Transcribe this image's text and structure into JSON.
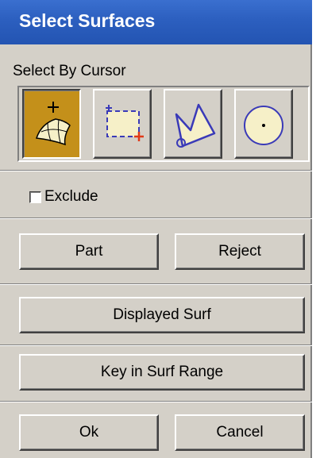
{
  "window": {
    "title": "Select Surfaces"
  },
  "select_by_cursor": {
    "label": "Select By Cursor",
    "tools": [
      {
        "icon": "surface-pick-icon",
        "active": true
      },
      {
        "icon": "box-select-icon",
        "active": false
      },
      {
        "icon": "polygon-select-icon",
        "active": false
      },
      {
        "icon": "circle-select-icon",
        "active": false
      }
    ]
  },
  "exclude": {
    "label": "Exclude",
    "checked": false
  },
  "buttons": {
    "part": "Part",
    "reject": "Reject",
    "displayed_surf": "Displayed Surf",
    "key_in_surf_range": "Key in Surf Range",
    "ok": "Ok",
    "cancel": "Cancel"
  },
  "colors": {
    "title_bar": "#2c5fbf",
    "dialog_bg": "#d4d0c8",
    "active_tool": "#c4901a"
  }
}
